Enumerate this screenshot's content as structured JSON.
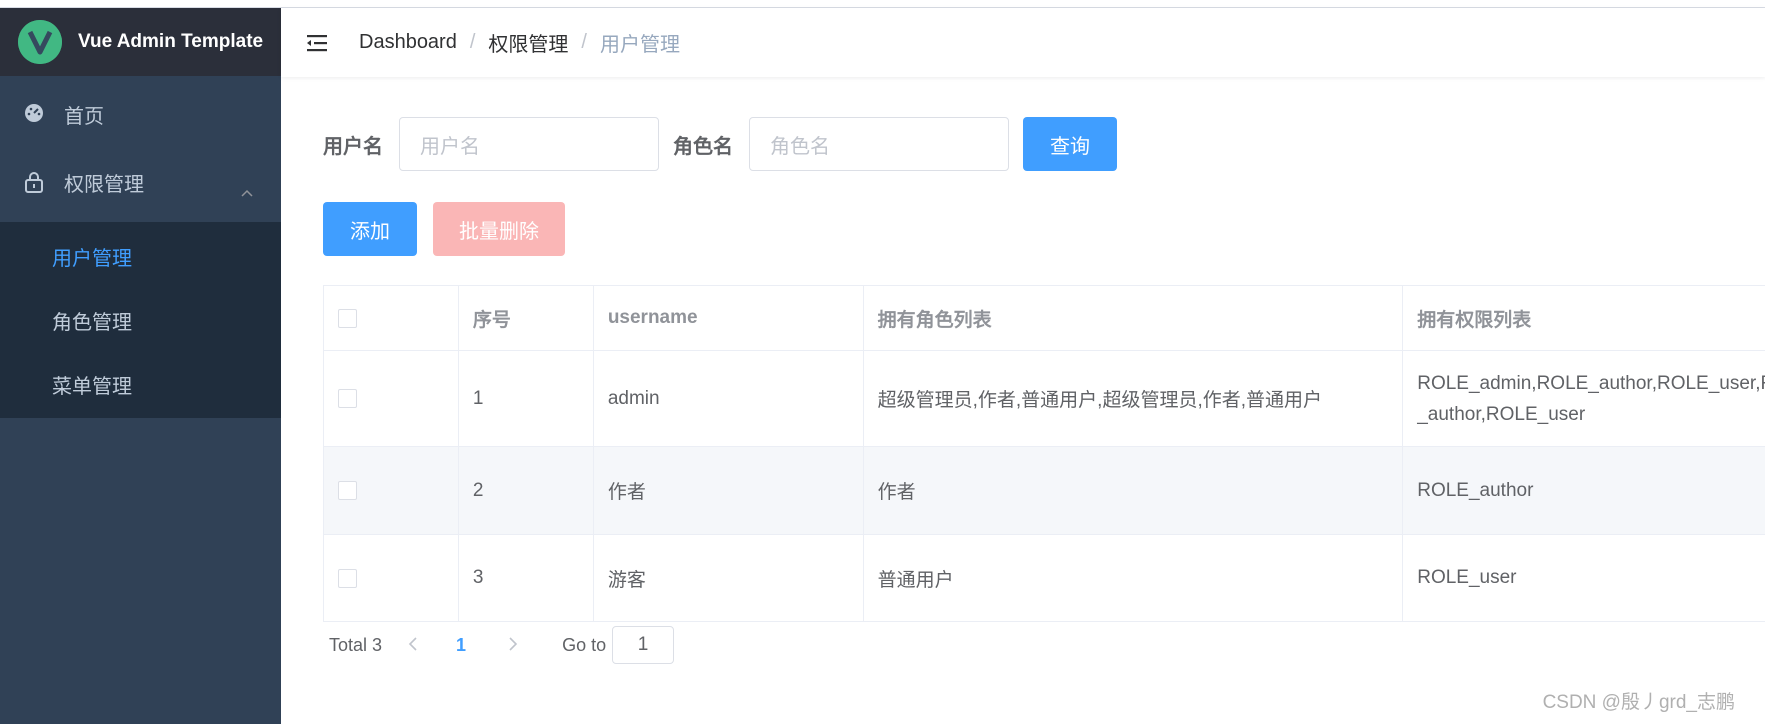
{
  "app": {
    "title": "Vue Admin Template"
  },
  "sidebar": {
    "items": [
      {
        "label": "首页",
        "icon": "dashboard-icon"
      },
      {
        "label": "权限管理",
        "icon": "lock-icon",
        "expanded": true
      }
    ],
    "submenu": [
      {
        "label": "用户管理",
        "active": true
      },
      {
        "label": "角色管理",
        "active": false
      },
      {
        "label": "菜单管理",
        "active": false
      }
    ]
  },
  "breadcrumb": [
    "Dashboard",
    "权限管理",
    "用户管理"
  ],
  "filter": {
    "username_label": "用户名",
    "username_placeholder": "用户名",
    "role_label": "角色名",
    "role_placeholder": "角色名",
    "query_button": "查询"
  },
  "actions": {
    "add": "添加",
    "batch_delete": "批量删除"
  },
  "table": {
    "columns": [
      "序号",
      "username",
      "拥有角色列表",
      "拥有权限列表"
    ],
    "rows": [
      {
        "index": "1",
        "username": "admin",
        "roles": "超级管理员,作者,普通用户,超级管理员,作者,普通用户",
        "perms": "ROLE_admin,ROLE_author,ROLE_user,R",
        "perms_line2": "_author,ROLE_user"
      },
      {
        "index": "2",
        "username": "作者",
        "roles": "作者",
        "perms": "ROLE_author",
        "perms_line2": ""
      },
      {
        "index": "3",
        "username": "游客",
        "roles": "普通用户",
        "perms": "ROLE_user",
        "perms_line2": ""
      }
    ]
  },
  "pagination": {
    "total": "Total 3",
    "current": "1",
    "goto_label": "Go to",
    "goto_value": "1"
  },
  "watermark": "CSDN @殷丿grd_志鹏",
  "colors": {
    "sidebar_bg": "#304156",
    "primary": "#409eff",
    "danger_disabled": "#fab6b6"
  }
}
